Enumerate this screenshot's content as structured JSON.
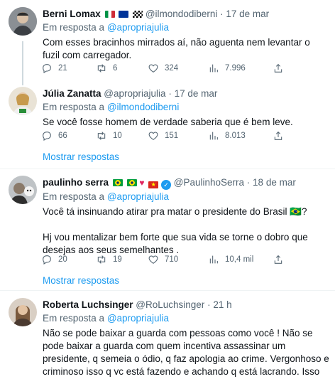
{
  "tweets": [
    {
      "name": "Berni Lomax",
      "handle": "@ilmondodiberni",
      "date": "17 de mar",
      "reply_prefix": "Em resposta a",
      "reply_to": "@apropriajulia",
      "text": [
        "Com esses bracinhos mirrados aí, não aguenta nem levantar o fuzil com carregador."
      ],
      "stats": {
        "replies": "21",
        "retweets": "6",
        "likes": "324",
        "views": "7.996"
      },
      "avatar_color": "#8a8f94"
    },
    {
      "name": "Júlia Zanatta",
      "handle": "@apropriajulia",
      "date": "17 de mar",
      "reply_prefix": "Em resposta a",
      "reply_to": "@ilmondodiberni",
      "text": [
        "Se você fosse homem de verdade saberia que é bem leve."
      ],
      "stats": {
        "replies": "66",
        "retweets": "10",
        "likes": "151",
        "views": "8.013"
      },
      "avatar_color": "#c9a26b"
    },
    {
      "name": "paulinho serra",
      "handle": "@PaulinhoSerra",
      "date": "18 de mar",
      "reply_prefix": "Em resposta a",
      "reply_to": "@apropriajulia",
      "text": [
        "Você tá insinuando atirar pra matar o presidente do Brasil 🇧🇷?",
        "Hj vou mentalizar bem forte que sua vida se torne o dobro que desejas aos seus semelhantes ."
      ],
      "stats": {
        "replies": "20",
        "retweets": "19",
        "likes": "710",
        "views": "10,4 mil"
      },
      "avatar_color": "#5b5f62"
    },
    {
      "name": "Roberta Luchsinger",
      "handle": "@RoLuchsinger",
      "date": "21 h",
      "reply_prefix": "Em resposta a",
      "reply_to": "@apropriajulia",
      "text": [
        "Não se pode baixar a guarda com pessoas como você ! Não se pode baixar a guarda com quem incentiva assassinar um presidente, q semeia o ódio, q faz apologia ao crime. Vergonhoso e criminoso isso q vc está fazendo e achando q está lacrando. Isso não é política. Isso é crime."
      ],
      "avatar_color": "#b08a66"
    }
  ],
  "show_replies": "Mostrar respostas",
  "separator": "·",
  "icons": [
    "reply-icon",
    "retweet-icon",
    "like-icon",
    "views-icon",
    "share-icon"
  ],
  "colors": {
    "link": "#1d9bf0",
    "muted": "#536471",
    "text": "#0f1419",
    "divider": "#eff3f4"
  }
}
